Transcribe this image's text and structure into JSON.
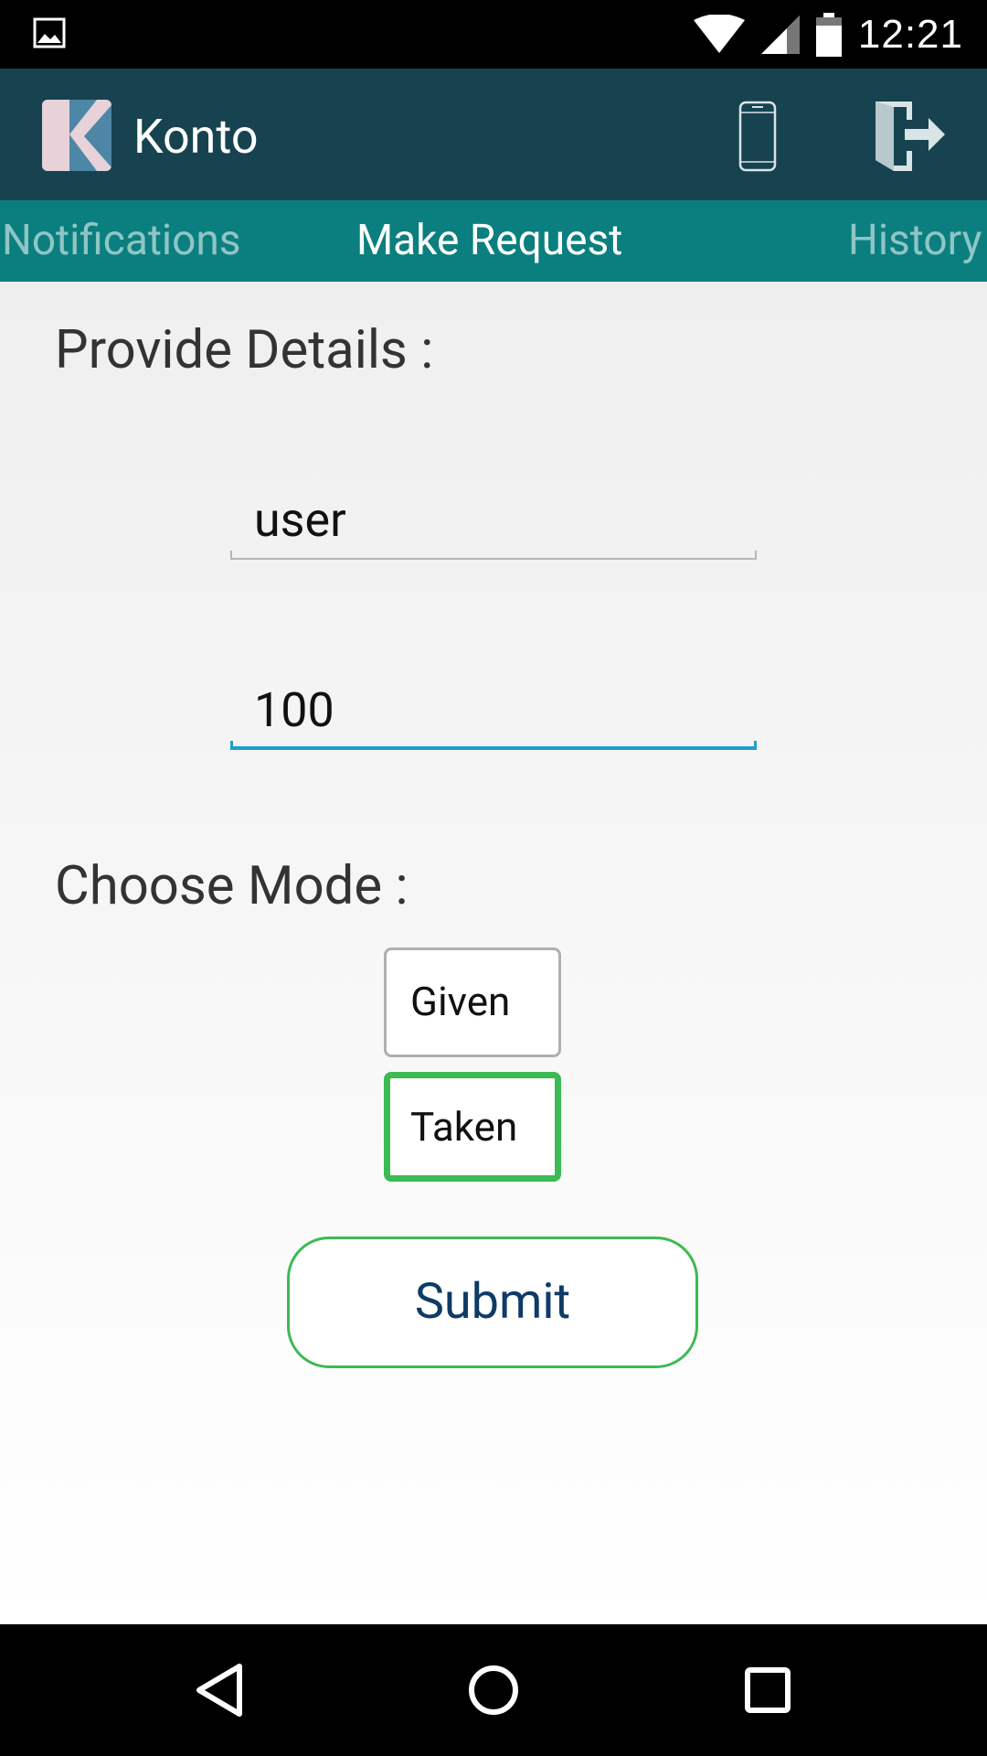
{
  "status_bar": {
    "time": "12:21",
    "left_icon": "image-notification-icon",
    "icons": [
      "wifi-icon",
      "signal-icon",
      "battery-icon"
    ]
  },
  "app_bar": {
    "logo_letter": "K",
    "title": "Konto",
    "actions": [
      "phone-icon",
      "logout-icon"
    ],
    "background_color": "#16434f"
  },
  "tabs": {
    "items": [
      {
        "label": "Notifications",
        "selected": false
      },
      {
        "label": "Make Request",
        "selected": true
      },
      {
        "label": "History",
        "selected": false
      }
    ],
    "background_color": "#0b7f7f"
  },
  "form": {
    "details_title": "Provide Details :",
    "user_value": "user",
    "amount_value": "100",
    "mode_title": "Choose Mode :",
    "modes": [
      {
        "label": "Given",
        "selected": false
      },
      {
        "label": "Taken",
        "selected": true
      }
    ],
    "submit_label": "Submit",
    "accent_color": "#3cba54",
    "focus_color": "#1e9fd1"
  },
  "nav_bar": {
    "buttons": [
      "back-icon",
      "home-icon",
      "recents-icon"
    ]
  }
}
